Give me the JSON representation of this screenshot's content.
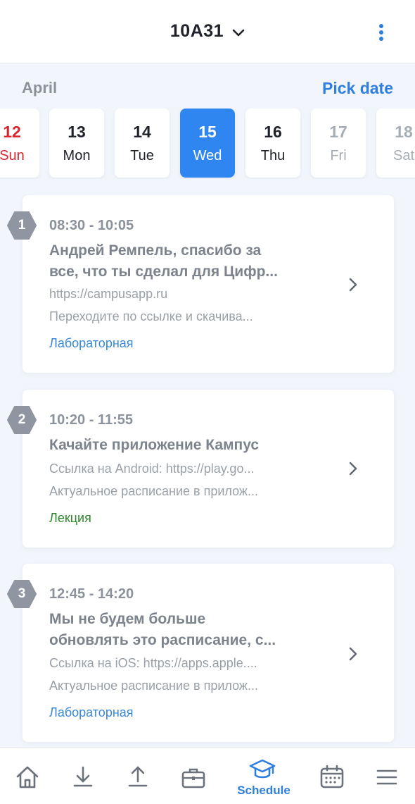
{
  "header": {
    "group": "10А31",
    "menu_icon": "kebab-icon"
  },
  "month": "April",
  "pick_date": "Pick date",
  "days": [
    {
      "num": "12",
      "weekday": "Sun",
      "state": "sunday"
    },
    {
      "num": "13",
      "weekday": "Mon",
      "state": "normal"
    },
    {
      "num": "14",
      "weekday": "Tue",
      "state": "normal"
    },
    {
      "num": "15",
      "weekday": "Wed",
      "state": "selected"
    },
    {
      "num": "16",
      "weekday": "Thu",
      "state": "normal"
    },
    {
      "num": "17",
      "weekday": "Fri",
      "state": "muted"
    },
    {
      "num": "18",
      "weekday": "Sat",
      "state": "muted"
    }
  ],
  "lessons": [
    {
      "index": "1",
      "time": "08:30 - 10:05",
      "subject_line1": "Андрей Ремпель, спасибо за",
      "subject_line2": "все, что ты сделал для Цифр...",
      "line1": "https://campusapp.ru",
      "line2": "Переходите по ссылке и скачива...",
      "kind": "Лабораторная"
    },
    {
      "index": "2",
      "time": "10:20 - 11:55",
      "subject_line1": "Качайте приложение Кампус",
      "line1": "Ссылка на Android: https://play.go...",
      "line2": "Актуальное расписание в прилож...",
      "kind": "Лекция"
    },
    {
      "index": "3",
      "time": "12:45 - 14:20",
      "subject_line1": "Мы не будем больше",
      "subject_line2": "обновлять это расписание, с...",
      "line1": "Ссылка на iOS: https://apps.apple....",
      "line2": "Актуальное расписание в прилож...",
      "kind": "Лабораторная"
    }
  ],
  "bottom_nav": {
    "active_label": "Schedule",
    "items": [
      "home-icon",
      "download-icon",
      "upload-icon",
      "briefcase-icon",
      "graduation-cap-icon",
      "calendar-icon",
      "hamburger-icon"
    ]
  },
  "colors": {
    "accent": "#2f86f0",
    "sunday": "#d7262f",
    "lab": "#3a86d9",
    "lecture": "#2b8a2b"
  }
}
